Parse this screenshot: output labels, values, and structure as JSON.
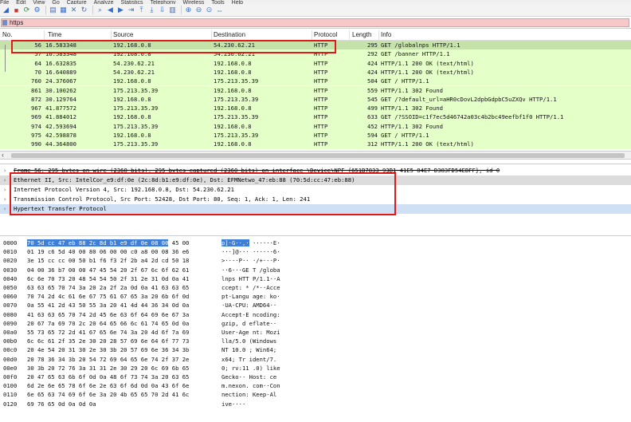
{
  "menu": [
    "File",
    "Edit",
    "View",
    "Go",
    "Capture",
    "Analyze",
    "Statistics",
    "Telephony",
    "Wireless",
    "Tools",
    "Help"
  ],
  "toolbar": {
    "icons": [
      "shark-fin-start-icon",
      "stop-icon",
      "restart-icon",
      "options-icon",
      "open-file-icon",
      "save-file-icon",
      "close-file-icon",
      "reload-icon",
      "find-icon",
      "go-back-icon",
      "go-forward-icon",
      "go-to-packet-icon",
      "first-packet-icon",
      "last-packet-icon",
      "autoscroll-icon",
      "colorize-icon",
      "zoom-in-icon",
      "zoom-out-icon",
      "zoom-normal-icon",
      "resize-columns-icon"
    ]
  },
  "filter": {
    "value": "https"
  },
  "columns": [
    "No.",
    "Time",
    "Source",
    "Destination",
    "Protocol",
    "Length",
    "Info"
  ],
  "packets": [
    {
      "no": "56",
      "time": "16.583348",
      "src": "192.168.0.8",
      "dst": "54.230.62.21",
      "proto": "HTTP",
      "len": "295",
      "info": "GET /globalnps HTTP/1.1"
    },
    {
      "no": "57",
      "time": "16.583348",
      "src": "192.168.0.8",
      "dst": "54.230.62.21",
      "proto": "HTTP",
      "len": "292",
      "info": "GET /banner HTTP/1.1"
    },
    {
      "no": "64",
      "time": "16.632835",
      "src": "54.230.62.21",
      "dst": "192.168.0.8",
      "proto": "HTTP",
      "len": "424",
      "info": "HTTP/1.1 200 OK  (text/html)"
    },
    {
      "no": "70",
      "time": "16.640889",
      "src": "54.230.62.21",
      "dst": "192.168.0.8",
      "proto": "HTTP",
      "len": "424",
      "info": "HTTP/1.1 200 OK  (text/html)"
    },
    {
      "no": "760",
      "time": "24.376067",
      "src": "192.168.0.8",
      "dst": "175.213.35.39",
      "proto": "HTTP",
      "len": "504",
      "info": "GET / HTTP/1.1"
    },
    {
      "no": "861",
      "time": "30.100262",
      "src": "175.213.35.39",
      "dst": "192.168.0.8",
      "proto": "HTTP",
      "len": "559",
      "info": "HTTP/1.1 302 Found"
    },
    {
      "no": "872",
      "time": "30.129764",
      "src": "192.168.0.8",
      "dst": "175.213.35.39",
      "proto": "HTTP",
      "len": "545",
      "info": "GET /?default_url=aHR0cDovL2dpbGdpbC5uZXQv HTTP/1.1"
    },
    {
      "no": "967",
      "time": "41.877572",
      "src": "175.213.35.39",
      "dst": "192.168.0.8",
      "proto": "HTTP",
      "len": "499",
      "info": "HTTP/1.1 302 Found"
    },
    {
      "no": "969",
      "time": "41.884012",
      "src": "192.168.0.8",
      "dst": "175.213.35.39",
      "proto": "HTTP",
      "len": "633",
      "info": "GET /?SSOID=c1f7ec5d46742a03c4b2bc49eefbf1f0 HTTP/1.1"
    },
    {
      "no": "974",
      "time": "42.593694",
      "src": "175.213.35.39",
      "dst": "192.168.0.8",
      "proto": "HTTP",
      "len": "452",
      "info": "HTTP/1.1 302 Found"
    },
    {
      "no": "975",
      "time": "42.598878",
      "src": "192.168.0.8",
      "dst": "175.213.35.39",
      "proto": "HTTP",
      "len": "594",
      "info": "GET / HTTP/1.1"
    },
    {
      "no": "990",
      "time": "44.364800",
      "src": "175.213.35.39",
      "dst": "192.168.0.8",
      "proto": "HTTP",
      "len": "312",
      "info": "HTTP/1.1 200 OK  (text/html)"
    }
  ],
  "details": [
    "Frame 56: 295 bytes on wire (2360 bits), 295 bytes captured (2360 bits) on interface \\Device\\NPF_{651B7833-93B1-41E5-84E7-D383FD54EBFF}, id 0",
    "Ethernet II, Src: IntelCor_e9:df:0e (2c:8d:b1:e9:df:0e), Dst: EFMNetwo_47:eb:88 (70:5d:cc:47:eb:88)",
    "Internet Protocol Version 4, Src: 192.168.0.8, Dst: 54.230.62.21",
    "Transmission Control Protocol, Src Port: 52428, Dst Port: 80, Seq: 1, Ack: 1, Len: 241",
    "Hypertext Transfer Protocol"
  ],
  "bytes": [
    {
      "off": "0000",
      "hex_hl": "70 5d cc 47 eb 88 2c 8d  b1 e9 df 0e 08 00",
      "hex": " 45 00",
      "ascii_hl": "p]·G··,·",
      "ascii": " ······E·"
    },
    {
      "off": "0010",
      "hex": "01 19 c6 5d 40 00 80 06  00 00 c0 a8 00 08 36 e6",
      "ascii": "···]@··· ······6·"
    },
    {
      "off": "0020",
      "hex": "3e 15 cc cc 00 50 b1 f6  f3 2f 2b a4 2d cd 50 18",
      "ascii": ">····P·· ·/+·-·P·"
    },
    {
      "off": "0030",
      "hex": "04 00 36 b7 00 00 47 45  54 20 2f 67 6c 6f 62 61",
      "ascii": "··6···GE T /globa"
    },
    {
      "off": "0040",
      "hex": "6c 6e 70 73 20 48 54 54  50 2f 31 2e 31 0d 0a 41",
      "ascii": "lnps HTT P/1.1··A"
    },
    {
      "off": "0050",
      "hex": "63 63 65 70 74 3a 20 2a  2f 2a 0d 0a 41 63 63 65",
      "ascii": "ccept: * /*··Acce"
    },
    {
      "off": "0060",
      "hex": "70 74 2d 4c 61 6e 67 75  61 67 65 3a 20 6b 6f 0d",
      "ascii": "pt-Langu age: ko·"
    },
    {
      "off": "0070",
      "hex": "0a 55 41 2d 43 50 55 3a  20 41 4d 44 36 34 0d 0a",
      "ascii": "·UA-CPU:  AMD64··"
    },
    {
      "off": "0080",
      "hex": "41 63 63 65 70 74 2d 45  6e 63 6f 64 69 6e 67 3a",
      "ascii": "Accept-E ncoding:"
    },
    {
      "off": "0090",
      "hex": "20 67 7a 69 70 2c 20 64  65 66 6c 61 74 65 0d 0a",
      "ascii": " gzip, d eflate··"
    },
    {
      "off": "00a0",
      "hex": "55 73 65 72 2d 41 67 65  6e 74 3a 20 4d 6f 7a 69",
      "ascii": "User-Age nt: Mozi"
    },
    {
      "off": "00b0",
      "hex": "6c 6c 61 2f 35 2e 30 20  28 57 69 6e 64 6f 77 73",
      "ascii": "lla/5.0  (Windows"
    },
    {
      "off": "00c0",
      "hex": "20 4e 54 20 31 30 2e 30  3b 20 57 69 6e 36 34 3b",
      "ascii": " NT 10.0 ; Win64;"
    },
    {
      "off": "00d0",
      "hex": "20 78 36 34 3b 20 54 72  69 64 65 6e 74 2f 37 2e",
      "ascii": " x64; Tr ident/7."
    },
    {
      "off": "00e0",
      "hex": "30 3b 20 72 76 3a 31 31  2e 30 29 20 6c 69 6b 65",
      "ascii": "0; rv:11 .0) like"
    },
    {
      "off": "00f0",
      "hex": "20 47 65 63 6b 6f 0d 0a  48 6f 73 74 3a 20 63 65",
      "ascii": " Gecko·· Host: ce"
    },
    {
      "off": "0100",
      "hex": "6d 2e 6e 65 78 6f 6e 2e  63 6f 6d 0d 0a 43 6f 6e",
      "ascii": "m.nexon. com··Con"
    },
    {
      "off": "0110",
      "hex": "6e 65 63 74 69 6f 6e 3a  20 4b 65 65 70 2d 41 6c",
      "ascii": "nection:  Keep-Al"
    },
    {
      "off": "0120",
      "hex": "69 76 65 0d 0a 0d 0a",
      "ascii": "ive····"
    }
  ],
  "colors": {
    "row_bg": "#e4ffc7",
    "selected_row_bg": "#c5e3a9",
    "filter_bg": "#f8c8c8",
    "highlight_box": "#e01a1a",
    "hex_highlight": "#3d7fd9"
  }
}
